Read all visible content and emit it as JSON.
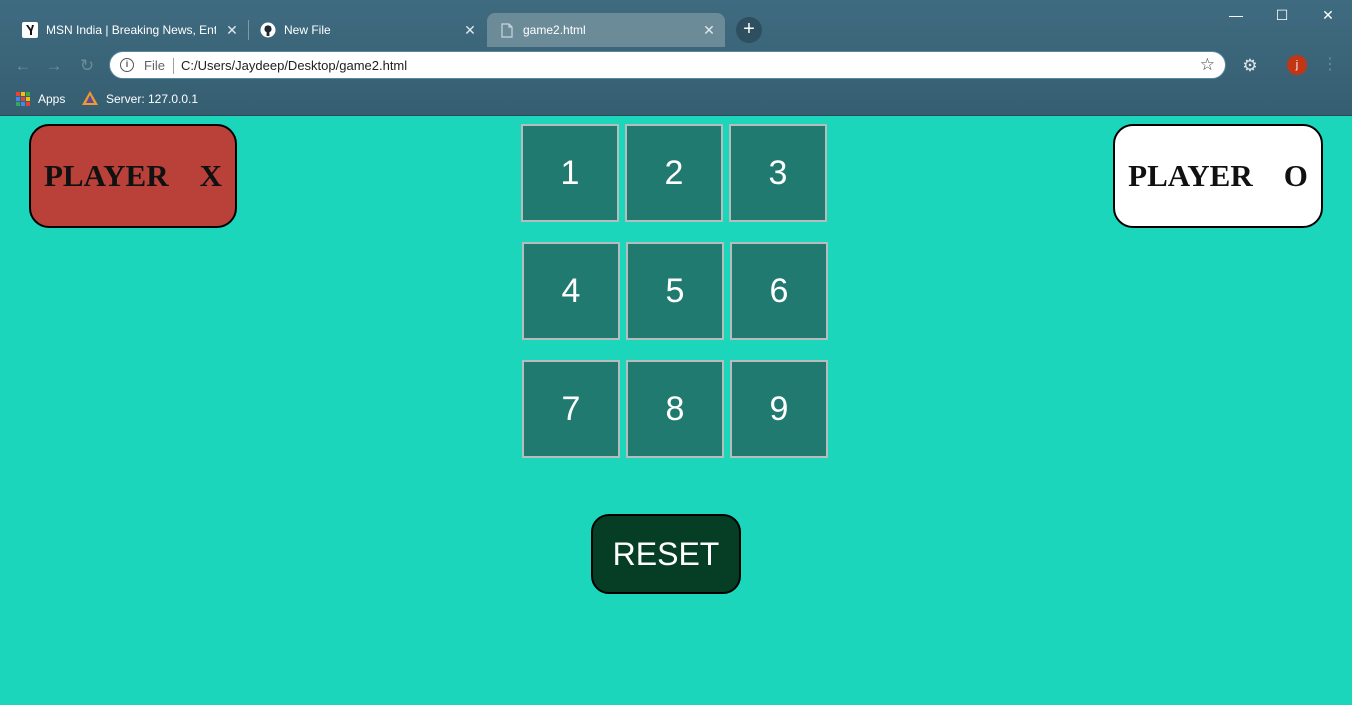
{
  "browser": {
    "tabs": [
      {
        "title": "MSN India | Breaking News, Enter",
        "favicon": "msn-icon"
      },
      {
        "title": "New File",
        "favicon": "github-icon"
      },
      {
        "title": "game2.html",
        "favicon": "file-icon",
        "active": true
      }
    ],
    "new_tab_label": "+",
    "window_controls": {
      "minimize": "—",
      "maximize": "☐",
      "close": "✕"
    },
    "omnibox": {
      "scheme_label": "File",
      "url": "C:/Users/Jaydeep/Desktop/game2.html"
    },
    "profile_initial": "j",
    "bookmarks": [
      {
        "label": "Apps",
        "icon": "apps-grid-icon"
      },
      {
        "label": "Server: 127.0.0.1",
        "icon": "server-icon"
      }
    ]
  },
  "game": {
    "player_x_label": "PLAYER    X",
    "player_o_label": "PLAYER    O",
    "cells": [
      "1",
      "2",
      "3",
      "4",
      "5",
      "6",
      "7",
      "8",
      "9"
    ],
    "reset_label": "RESET"
  },
  "colors": {
    "page_background": "#1bd6bb",
    "cell_background": "#217a70",
    "player_x_background": "#b94139",
    "player_o_background": "#ffffff",
    "reset_background": "#063e25"
  }
}
